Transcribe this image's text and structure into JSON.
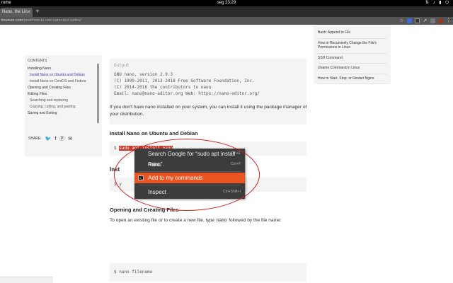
{
  "system_bar": {
    "app_name": "rome",
    "clock": "seg 23:29",
    "icons": [
      "network-icon",
      "volume-icon",
      "battery-icon",
      "power-icon"
    ]
  },
  "browser": {
    "tab_title": "Nano, the Lin",
    "new_tab_label": "+",
    "url_domain": "linuxize.com",
    "url_path": "/post/how-to-use-nano-text-editor/"
  },
  "toc": {
    "title": "CONTENTS",
    "items": [
      {
        "label": "Installing Nano",
        "sub": false,
        "active": false
      },
      {
        "label": "Install Nano on Ubuntu and Debian",
        "sub": true,
        "active": true
      },
      {
        "label": "Install Nano on CentOS and Fedora",
        "sub": true,
        "active": false
      },
      {
        "label": "Opening and Creating Files",
        "sub": false,
        "active": false
      },
      {
        "label": "Editing Files",
        "sub": false,
        "active": false
      },
      {
        "label": "Searching and replacing",
        "sub": true,
        "active": false
      },
      {
        "label": "Copying, cutting, and pasting",
        "sub": true,
        "active": false
      },
      {
        "label": "Saving and Exiting",
        "sub": false,
        "active": false
      }
    ],
    "share_label": "SHARE:"
  },
  "related": {
    "items": [
      "Bash: Append to File",
      "How to Recursively Change the File's Permissions in Linux",
      "SSH Command",
      "Uname Command in Linux",
      "How to Start, Stop, or Restart Nginx"
    ]
  },
  "article": {
    "output_label": "Output",
    "output_lines": [
      "GNU nano, version 2.9.3",
      "(C) 1999-2011, 2013-2018 Free Software Foundation, Inc.",
      "(C) 2014-2018 the contributors to nano",
      "Email: nano@nano-editor.org Web: https://nano-editor.org/"
    ],
    "para_install": "If you don't have nano installed on your system, you can install it using the package manager of your distribution.",
    "heading_ubuntu": "Install Nano on Ubuntu and Debian",
    "cmd_prompt": "$ ",
    "cmd_ubuntu": "sudo apt install nano",
    "heading_centos_partial": "Inst",
    "cmd_centos_partial": "$ y",
    "heading_open": "Opening and Creating Files",
    "para_open_1": "To open an existing file or to create a new file, type ",
    "para_open_code": "nano",
    "para_open_2": " followed by the file name:",
    "cmd_filename": "$ nano filename"
  },
  "context_menu": {
    "items": [
      {
        "label": "Search Google for “sudo apt install nano”",
        "shortcut": "Ctrl+E",
        "highlighted": false,
        "icon": null
      },
      {
        "label": "Print...",
        "shortcut": "Ctrl+P",
        "highlighted": false,
        "icon": null
      },
      {
        "label": "Add to my commands",
        "shortcut": "",
        "highlighted": true,
        "icon": "terminal-icon"
      },
      {
        "label": "Inspect",
        "shortcut": "Ctrl+Shift+I",
        "highlighted": false,
        "icon": null
      }
    ]
  },
  "colors": {
    "accent_orange": "#e95420",
    "selection_red": "#c33a2e",
    "annotation_red": "#d02020",
    "toc_active": "#3b36b3"
  }
}
